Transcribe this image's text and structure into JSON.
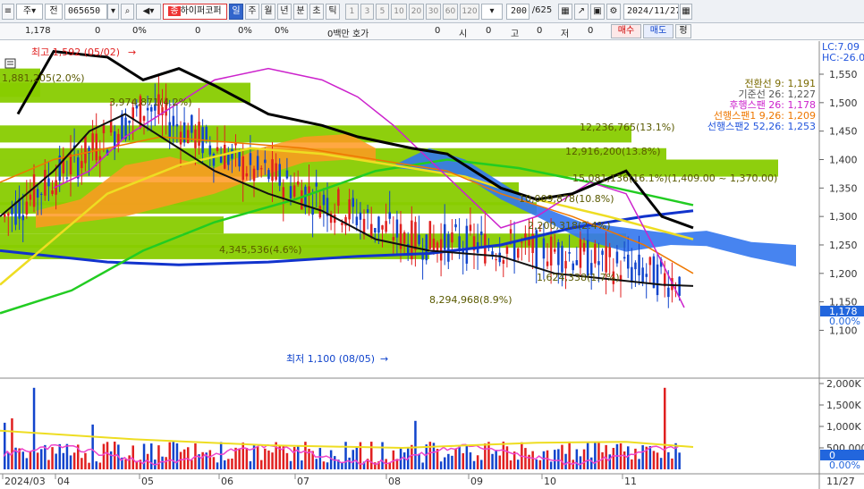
{
  "toolbar": {
    "period_code": "주",
    "prev_label": "전",
    "stock_code": "065650",
    "stock_name": "하이퍼코퍼",
    "chart_types": [
      "일",
      "주",
      "월",
      "년",
      "분",
      "초",
      "틱"
    ],
    "period_buttons": [
      "1",
      "3",
      "5",
      "10",
      "20",
      "30",
      "60",
      "120"
    ],
    "count": "200",
    "total": "/625",
    "date": "2024/11/27"
  },
  "info": {
    "price": "1,178",
    "v1": "0",
    "v2": "0%",
    "v3": "0",
    "v4": "0%",
    "v5": "0%",
    "amount_label": "0백만 호가",
    "quote": "0",
    "open_label": "시",
    "open": "0",
    "high_label": "고",
    "high": "0",
    "low_label": "저",
    "low": "0",
    "buy_label": "매수",
    "sell_label": "매도",
    "avg_label": "평"
  },
  "annotations": {
    "high": "최고 1,592 (05/02)",
    "low": "최저 1,100 (08/05)"
  },
  "volume_profile": [
    {
      "label": "12,236,765(13.1%)"
    },
    {
      "label": "12,916,200(13.8%)"
    },
    {
      "label": "15,081,136(16.1%)(1,409.00 ~ 1,370.00)"
    },
    {
      "label": "10,009,878(10.8%)"
    },
    {
      "label": "4,345,536(4.6%)"
    },
    {
      "label": "8,294,968(8.9%)"
    },
    {
      "label": "3,974,871(4.2%)"
    },
    {
      "label": "1,881,205(2.0%)"
    },
    {
      "label": "1,624,338(1.7%)"
    },
    {
      "label": "2,200,318(2.4%)"
    }
  ],
  "legend": [
    {
      "text": "전환선 9: 1,191",
      "color": "#7a6a00"
    },
    {
      "text": "기준선 26: 1,227",
      "color": "#555555"
    },
    {
      "text": "후행스팬 26: 1,178",
      "color": "#cc22cc"
    },
    {
      "text": "선행스팬1 9,26: 1,209",
      "color": "#ee7700"
    },
    {
      "text": "선행스팬2 52,26: 1,253",
      "color": "#2255dd"
    }
  ],
  "axis": {
    "lc": "LC:7.09",
    "hc": "HC:-26.0",
    "price_ticks": [
      "1,550",
      "1,500",
      "1,450",
      "1,400",
      "1,350",
      "1,300",
      "1,250",
      "1,200",
      "1,150",
      "1,100"
    ],
    "current_price": "1,178",
    "current_pct": "0.00%",
    "volume_ticks": [
      "2,000K",
      "1,500K",
      "1,000K",
      "500,000"
    ],
    "volume_zero": "0",
    "volume_pct": "0.00%",
    "x_labels": [
      "2024/03",
      "04",
      "05",
      "06",
      "07",
      "08",
      "09",
      "10",
      "11"
    ],
    "x_end": "11/27"
  },
  "colors": {
    "profile_bar": "#88cc00",
    "candle_up": "#e02020",
    "candle_down": "#1144cc",
    "cloud_bull": "#ff9922",
    "cloud_bear": "#3377ee"
  }
}
